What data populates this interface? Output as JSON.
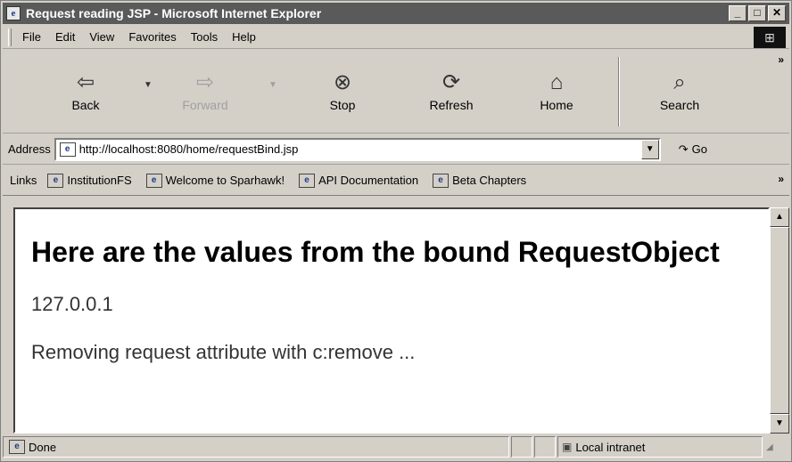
{
  "window": {
    "title": "Request reading JSP - Microsoft Internet Explorer",
    "min_label": "_",
    "max_label": "□",
    "close_label": "✕"
  },
  "menu": {
    "items": [
      {
        "label": "File"
      },
      {
        "label": "Edit"
      },
      {
        "label": "View"
      },
      {
        "label": "Favorites"
      },
      {
        "label": "Tools"
      },
      {
        "label": "Help"
      }
    ]
  },
  "toolbar": {
    "back": {
      "label": "Back",
      "icon": "back-arrow-icon"
    },
    "forward": {
      "label": "Forward",
      "icon": "forward-arrow-icon"
    },
    "stop": {
      "label": "Stop",
      "icon": "stop-icon"
    },
    "refresh": {
      "label": "Refresh",
      "icon": "refresh-icon"
    },
    "home": {
      "label": "Home",
      "icon": "home-icon"
    },
    "search": {
      "label": "Search",
      "icon": "search-icon"
    }
  },
  "address": {
    "label": "Address",
    "url": "http://localhost:8080/home/requestBind.jsp",
    "go_label": "Go"
  },
  "links": {
    "label": "Links",
    "items": [
      {
        "label": "InstitutionFS"
      },
      {
        "label": "Welcome to Sparhawk!"
      },
      {
        "label": "API Documentation"
      },
      {
        "label": "Beta Chapters"
      }
    ]
  },
  "content": {
    "heading": "Here are the values from the bound RequestObject",
    "value": "127.0.0.1",
    "message": "Removing request attribute with c:remove ..."
  },
  "status": {
    "text": "Done",
    "zone": "Local intranet"
  }
}
